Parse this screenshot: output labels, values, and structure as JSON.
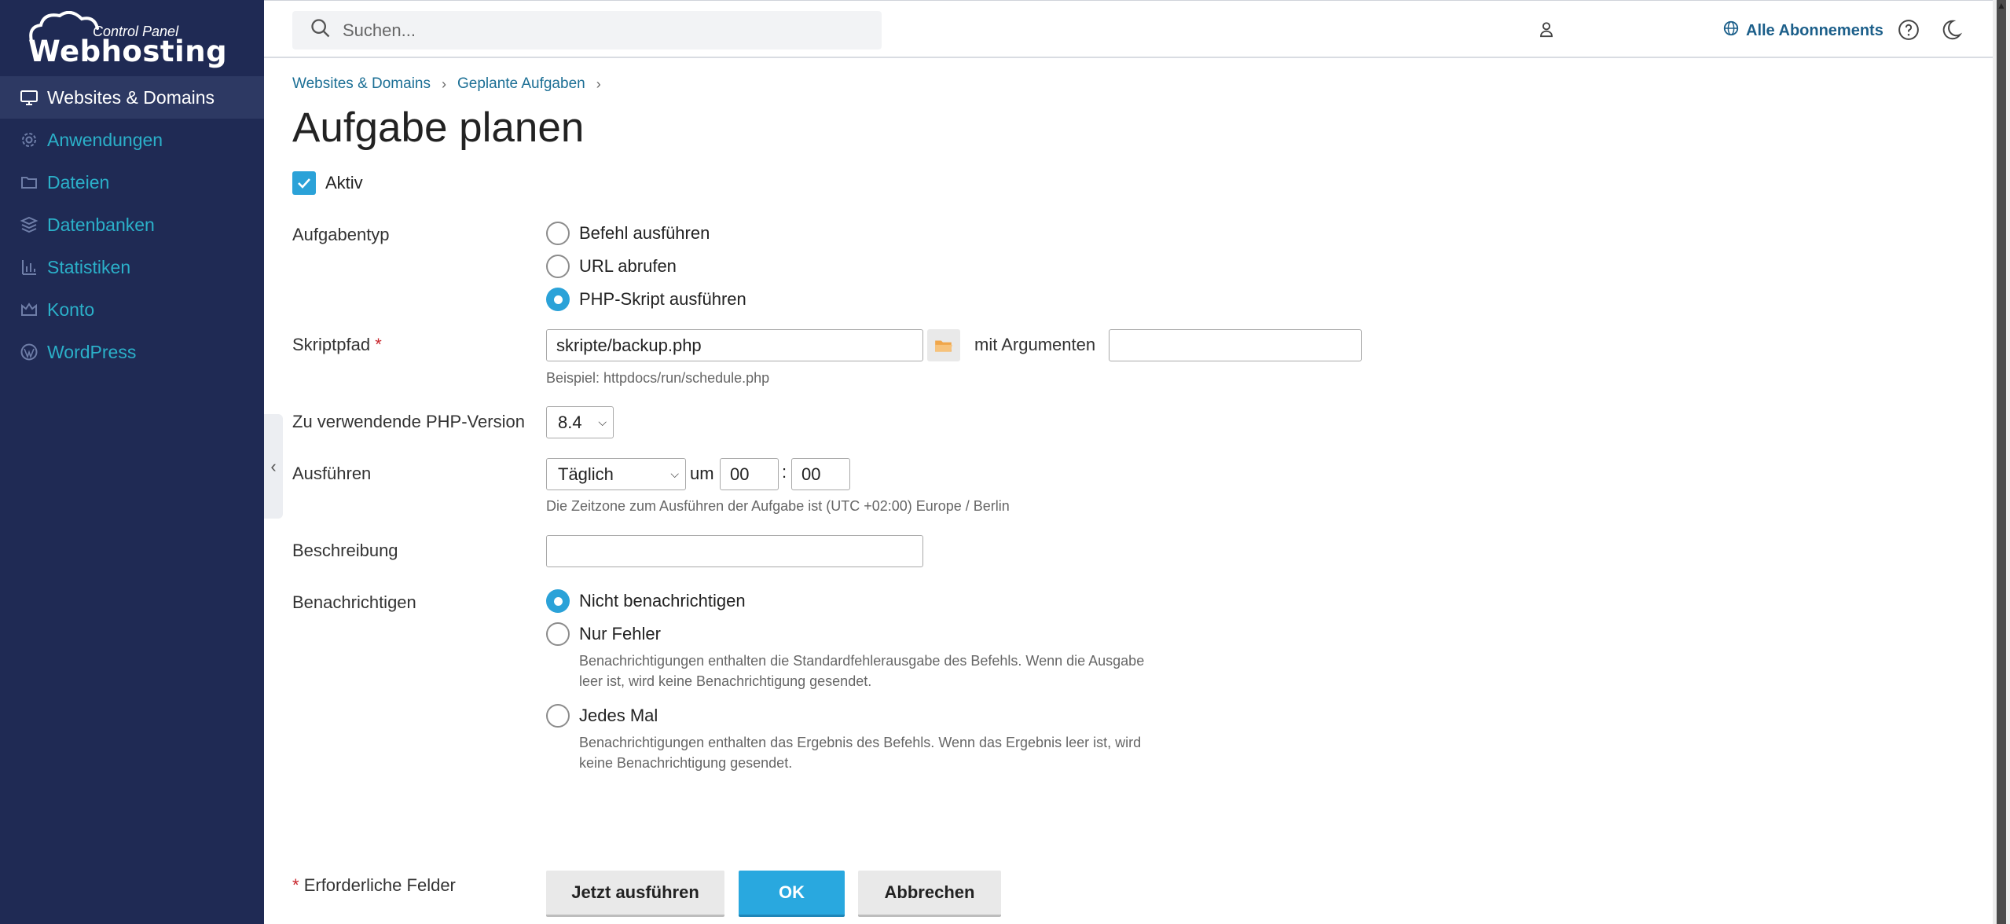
{
  "logo": {
    "brand": "Webhosting",
    "subtitle": "Control Panel"
  },
  "sidebar": {
    "items": [
      {
        "label": "Websites & Domains",
        "icon": "monitor-icon",
        "active": true
      },
      {
        "label": "Anwendungen",
        "icon": "gear-icon"
      },
      {
        "label": "Dateien",
        "icon": "folder-icon"
      },
      {
        "label": "Datenbanken",
        "icon": "database-icon"
      },
      {
        "label": "Statistiken",
        "icon": "bar-chart-icon"
      },
      {
        "label": "Konto",
        "icon": "crown-icon"
      },
      {
        "label": "WordPress",
        "icon": "wordpress-icon"
      }
    ]
  },
  "header": {
    "search_placeholder": "Suchen...",
    "subscriptions_label": "Alle Abonnements"
  },
  "breadcrumb": {
    "items": [
      "Websites & Domains",
      "Geplante Aufgaben"
    ]
  },
  "page_title": "Aufgabe planen",
  "form": {
    "active_label": "Aktiv",
    "active_checked": true,
    "task_type": {
      "label": "Aufgabentyp",
      "options": [
        "Befehl ausführen",
        "URL abrufen",
        "PHP-Skript ausführen"
      ],
      "selected": "PHP-Skript ausführen"
    },
    "script_path": {
      "label": "Skriptpfad",
      "required_marker": "*",
      "value": "skripte/backup.php",
      "hint": "Beispiel: httpdocs/run/schedule.php",
      "args_label": "mit Argumenten",
      "args_value": ""
    },
    "php_version": {
      "label": "Zu verwendende PHP-Version",
      "value": "8.4"
    },
    "run": {
      "label": "Ausführen",
      "frequency": "Täglich",
      "at_label": "um",
      "hour": "00",
      "colon": ":",
      "minute": "00",
      "hint": "Die Zeitzone zum Ausführen der Aufgabe ist (UTC +02:00) Europe / Berlin"
    },
    "description": {
      "label": "Beschreibung",
      "value": ""
    },
    "notify": {
      "label": "Benachrichtigen",
      "selected": "Nicht benachrichtigen",
      "options": [
        {
          "label": "Nicht benachrichtigen",
          "hint": ""
        },
        {
          "label": "Nur Fehler",
          "hint": "Benachrichtigungen enthalten die Standardfehlerausgabe des Befehls. Wenn die Ausgabe leer ist, wird keine Benachrichtigung gesendet."
        },
        {
          "label": "Jedes Mal",
          "hint": "Benachrichtigungen enthalten das Ergebnis des Befehls. Wenn das Ergebnis leer ist, wird keine Benachrichtigung gesendet."
        }
      ]
    },
    "required_note": {
      "marker": "*",
      "text": "Erforderliche Felder"
    },
    "buttons": {
      "run_now": "Jetzt ausführen",
      "ok": "OK",
      "cancel": "Abbrechen"
    }
  },
  "colors": {
    "sidebar_bg": "#1f2a54",
    "accent": "#29a8df",
    "link": "#1c6f95",
    "nav_text": "#2bb0c9"
  }
}
